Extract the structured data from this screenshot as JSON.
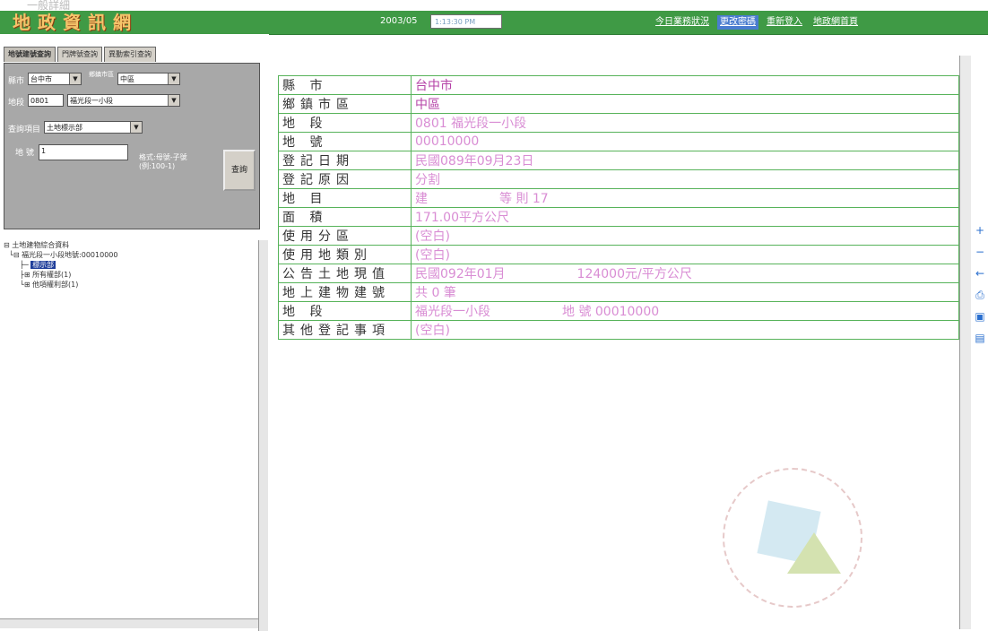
{
  "window_title": "一般詳細",
  "app": {
    "logo_chars": [
      "地",
      "政",
      "資",
      "訊",
      "網"
    ],
    "date_label": "2003/05",
    "date_field": "1:13:30 PM"
  },
  "top_links": [
    {
      "label": "今日業務狀況",
      "highlight": false
    },
    {
      "label": "更改密碼",
      "highlight": true
    },
    {
      "label": "重新登入",
      "highlight": false
    },
    {
      "label": "地政網首頁",
      "highlight": false
    }
  ],
  "query": {
    "tabs": [
      "地號建號查詢",
      "門牌號查詢",
      "異動索引查詢"
    ],
    "county_label": "縣市",
    "county_value": "台中市",
    "district_label": "鄉鎮市區",
    "district_value": "中區",
    "section_label": "地段",
    "section_code": "0801",
    "section_value": "福光段一小段",
    "item_label": "查詢項目",
    "item_value": "土地標示部",
    "number_label": "地 號",
    "number_value": "1",
    "format_note": "格式:母號-子號",
    "format_example": "(例:100-1)",
    "button": "查詢"
  },
  "tree": {
    "root": "土地建物綜合資料",
    "parcel": "福光段一小段地號:00010000",
    "selected": "標示部",
    "owner": "所有權部(1)",
    "other": "他項權利部(1)"
  },
  "record": {
    "rows": [
      {
        "label": "縣 市",
        "value": "台中市"
      },
      {
        "label": "鄉鎮市區",
        "value": "中區"
      },
      {
        "label": "地 段",
        "value": "0801 福光段一小段"
      },
      {
        "label": "地 號",
        "value": "00010000"
      },
      {
        "label": "登記日期",
        "value": "民國089年09月23日"
      },
      {
        "label": "登記原因",
        "value": "分割"
      },
      {
        "label": "地 目",
        "value": "建",
        "extra": "等 則 17"
      },
      {
        "label": "面 積",
        "value": "171.00平方公尺"
      },
      {
        "label": "使用分區",
        "value": "(空白)"
      },
      {
        "label": "使用地類別",
        "value": "(空白)"
      },
      {
        "label": "公告土地現值",
        "value": "民國092年01月",
        "extra": "124000元/平方公尺"
      },
      {
        "label": "地上建物建號",
        "value": "共 0 筆"
      },
      {
        "label": "地 段",
        "value": "福光段一小段",
        "extra": "地 號 00010000"
      },
      {
        "label": "其他登記事項",
        "value": "(空白)"
      }
    ]
  }
}
